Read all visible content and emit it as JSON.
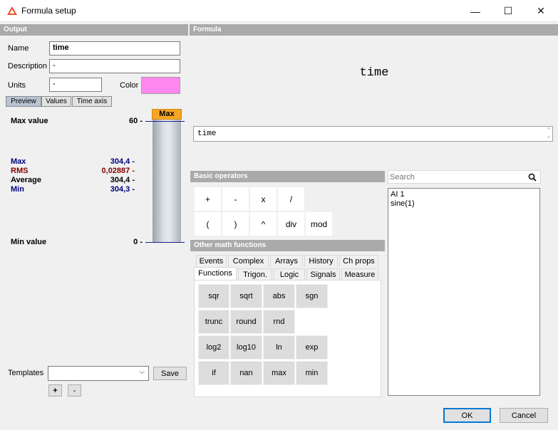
{
  "window": {
    "title": "Formula setup",
    "minimize_glyph": "—",
    "maximize_glyph": "☐",
    "close_glyph": "✕"
  },
  "output": {
    "header": "Output",
    "name_label": "Name",
    "name_value": "time",
    "description_label": "Description",
    "description_value": "-",
    "units_label": "Units",
    "units_value": "-",
    "color_label": "Color",
    "color_value": "#ff88ee",
    "tabs": [
      "Preview",
      "Values",
      "Time axis"
    ],
    "max_value_label": "Max value",
    "max_value_tick": "60 -",
    "min_value_label": "Min value",
    "min_value_tick": "0 -",
    "bar_label": "Max",
    "stats": [
      {
        "label": "Max",
        "value": "304,4 -",
        "color": "#000080"
      },
      {
        "label": "RMS",
        "value": "0,02887 -",
        "color": "#800000"
      },
      {
        "label": "Average",
        "value": "304,4 -",
        "color": "#000000"
      },
      {
        "label": "Min",
        "value": "304,3 -",
        "color": "#000080"
      }
    ],
    "templates_label": "Templates",
    "templates_value": "",
    "save_label": "Save",
    "plus_label": "+",
    "minus_label": "-"
  },
  "formula": {
    "header": "Formula",
    "preview": "time",
    "input_value": "time"
  },
  "basic_operators": {
    "header": "Basic operators",
    "row1": [
      "+",
      "-",
      "x",
      "/"
    ],
    "row2": [
      "(",
      ")",
      "^",
      "div",
      "mod"
    ]
  },
  "other_math": {
    "header": "Other math functions",
    "tabs_top": [
      "Events",
      "Complex",
      "Arrays",
      "History",
      "Ch props"
    ],
    "tabs_bottom": [
      "Functions",
      "Trigon.",
      "Logic",
      "Signals",
      "Measure"
    ],
    "functions": [
      [
        "sqr",
        "sqrt",
        "abs",
        "sgn"
      ],
      [
        "trunc",
        "round",
        "rnd"
      ],
      [
        "log2",
        "log10",
        "ln",
        "exp"
      ],
      [
        "if",
        "nan",
        "max",
        "min"
      ]
    ]
  },
  "search": {
    "placeholder": "Search",
    "items": [
      "AI 1",
      "sine(1)"
    ]
  },
  "footer": {
    "ok_label": "OK",
    "cancel_label": "Cancel"
  }
}
